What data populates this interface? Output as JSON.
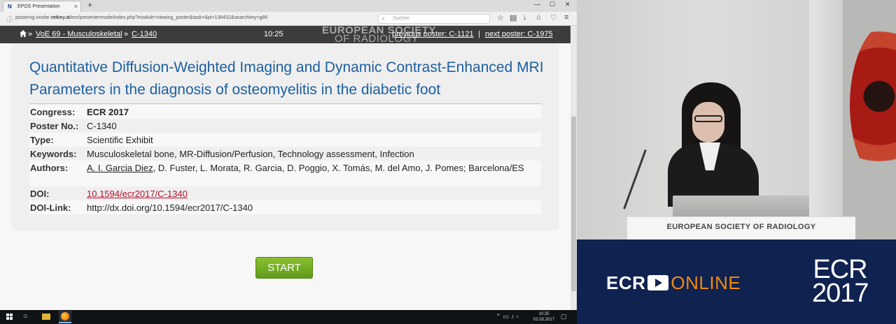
{
  "browser": {
    "tab_title": "EPOS Presentation",
    "favicon": "N",
    "url_prefix": "posterng-onsite.",
    "url_domain": "netkey.at",
    "url_rest": "/esr/presentermode/index.php?module=viewing_poster&task=&pi=138432&searchkey=g86",
    "search_placeholder": "Suchen"
  },
  "poster_header": {
    "crumb_1": "VoE 69 - Musculoskeletal",
    "crumb_2": "C-1340",
    "time": "10:25",
    "logo_line1": "EUROPEAN SOCIETY",
    "logo_line2": "OF RADIOLOGY",
    "previous": "previous poster: C-1121",
    "separator": "|",
    "next": "next poster: C-1975"
  },
  "poster": {
    "title": "Quantitative Diffusion-Weighted Imaging and Dynamic Contrast-Enhanced MRI Parameters in the diagnosis of osteomyelitis in the diabetic foot",
    "congress_label": "Congress:",
    "congress": "ECR 2017",
    "poster_no_label": "Poster No.:",
    "poster_no": "C-1340",
    "type_label": "Type:",
    "type": "Scientific Exhibit",
    "keywords_label": "Keywords:",
    "keywords": "Musculoskeletal bone, MR-Diffusion/Perfusion, Technology assessment, Infection",
    "authors_label": "Authors:",
    "author_first": "A. I. Garcia Diez",
    "authors_rest": ", D. Fuster, L. Morata, R. Garcia, D. Poggio, X. Tomás, M. del Amo, J. Pomes; Barcelona/ES",
    "doi_label": "DOI:",
    "doi": "10.1594/ecr2017/C-1340",
    "doi_link_label": "DOI-Link:",
    "doi_link": "http://dx.doi.org/10.1594/ecr2017/C-1340",
    "start_label": "START"
  },
  "taskbar": {
    "time": "10:25",
    "date": "02.03.2017"
  },
  "video": {
    "podium_label": "EUROPEAN SOCIETY OF RADIOLOGY",
    "ecr": "ECR",
    "online": "ONLINE",
    "year_ecr": "ECR",
    "year": "2017"
  },
  "colors": {
    "title_blue": "#1d5fa0",
    "header_dark": "#3c3c3c",
    "start_green": "#6fa821",
    "doi_red": "#b3102a",
    "banner_navy": "#10224f",
    "online_orange": "#f08a12"
  }
}
